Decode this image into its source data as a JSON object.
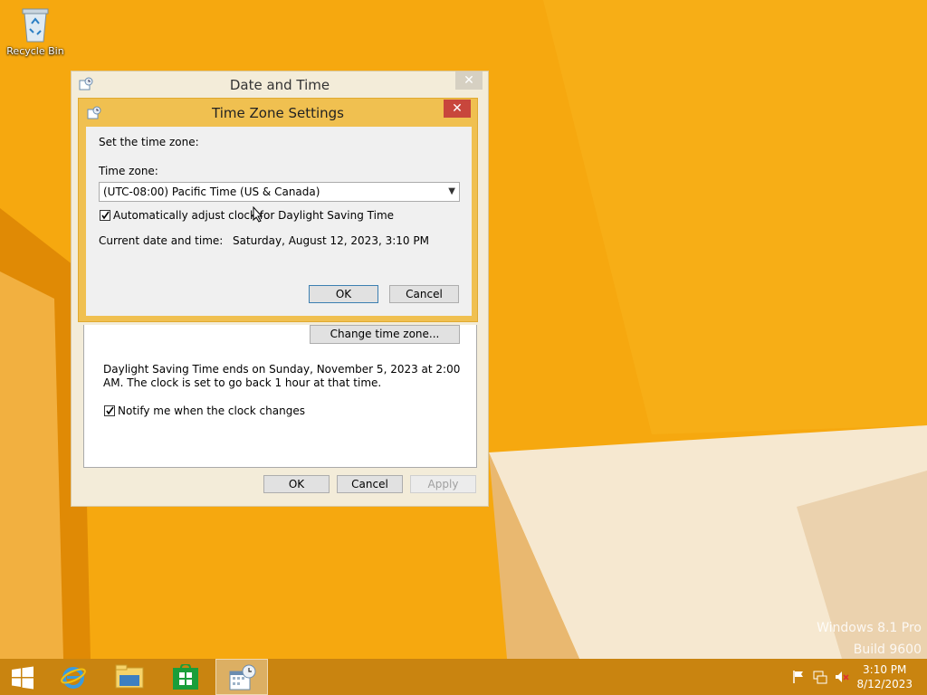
{
  "desktop": {
    "recycle_bin_label": "Recycle Bin",
    "watermark_line1": "Windows 8.1 Pro",
    "watermark_line2": "Build 9600"
  },
  "date_time_window": {
    "title": "Date and Time",
    "close_label": "✕",
    "change_time_zone_button": "Change time zone...",
    "dst_info": "Daylight Saving Time ends on Sunday, November 5, 2023 at 2:00 AM. The clock is set to go back 1 hour at that time.",
    "notify_label": "Notify me when the clock changes",
    "notify_checked": true,
    "ok": "OK",
    "cancel": "Cancel",
    "apply": "Apply"
  },
  "tz_dialog": {
    "title": "Time Zone Settings",
    "close_label": "✕",
    "set_label": "Set the time zone:",
    "tz_label": "Time zone:",
    "tz_value": "(UTC-08:00) Pacific Time (US & Canada)",
    "auto_dst_label": "Automatically adjust clock for Daylight Saving Time",
    "auto_dst_checked": true,
    "current_label": "Current date and time:",
    "current_value": "Saturday, August 12, 2023, 3:10 PM",
    "ok": "OK",
    "cancel": "Cancel"
  },
  "taskbar": {
    "items": [
      "start",
      "internet-explorer",
      "file-explorer",
      "store",
      "date-time-settings"
    ],
    "time": "3:10 PM",
    "date": "8/12/2023"
  },
  "colors": {
    "wallpaper": "#f5a20a",
    "taskbar": "#c98410",
    "tz_frame": "#f0c050",
    "close_red": "#c8463c"
  }
}
